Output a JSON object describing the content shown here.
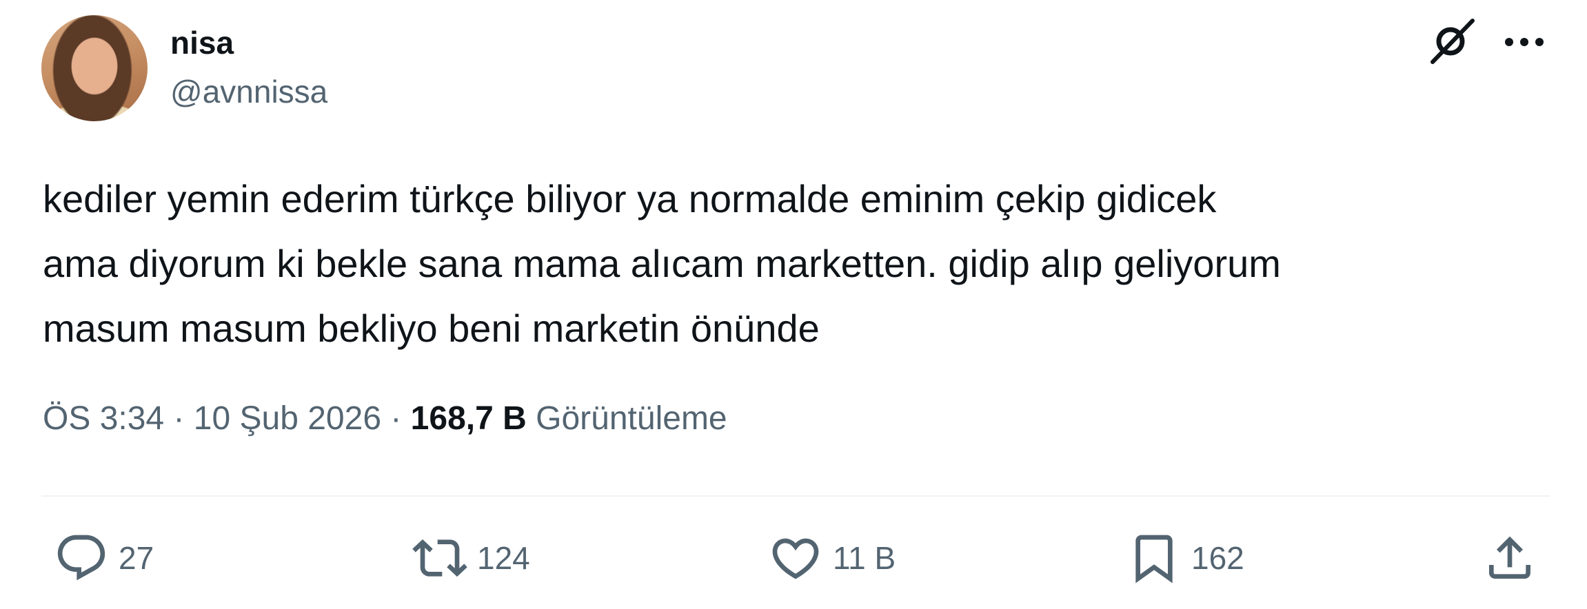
{
  "author": {
    "display_name": "nisa",
    "handle": "@avnnissa",
    "avatar_icon": "profile-photo"
  },
  "tweet": {
    "text_lines": [
      "kediler yemin ederim türkçe biliyor ya normalde eminim çekip gidicek",
      "ama diyorum ki bekle sana mama alıcam marketten. gidip alıp geliyorum",
      "masum masum bekliyo beni marketin önünde"
    ]
  },
  "meta": {
    "time": "ÖS 3:34",
    "separator": " · ",
    "date": "10 Şub 2026",
    "views_count": "168,7 B",
    "views_label": "Görüntüleme"
  },
  "actions": {
    "replies": {
      "icon": "reply-icon",
      "count": "27"
    },
    "reposts": {
      "icon": "repost-icon",
      "count": "124"
    },
    "likes": {
      "icon": "heart-icon",
      "count": "11 B"
    },
    "bookmarks": {
      "icon": "bookmark-icon",
      "count": "162"
    },
    "share": {
      "icon": "share-icon"
    }
  },
  "header_icons": {
    "grok": "grok-icon",
    "more": "more-icon"
  },
  "colors": {
    "text_primary": "#0f1419",
    "text_secondary": "#536471",
    "divider": "#eff3f4"
  }
}
